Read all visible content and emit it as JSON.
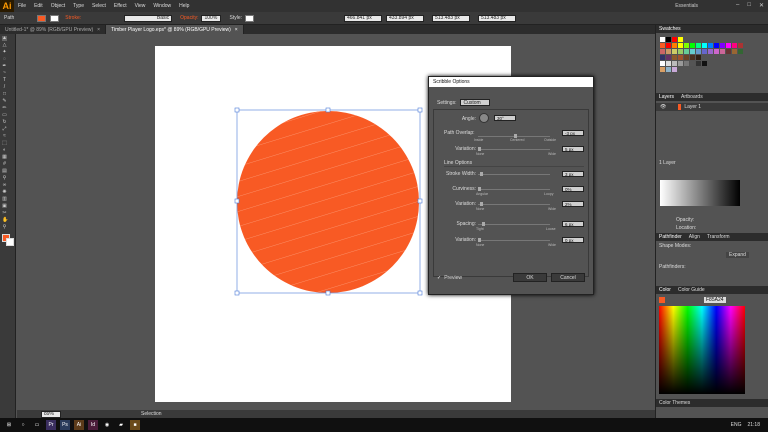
{
  "app": {
    "logo": "Ai"
  },
  "menu": [
    "File",
    "Edit",
    "Object",
    "Type",
    "Select",
    "Effect",
    "View",
    "Window",
    "Help"
  ],
  "workspace": "Essentials",
  "control_bar": {
    "object_label": "Path",
    "stroke_label": "Stroke:",
    "basic_label": "Basic",
    "opacity_label": "Opacity:",
    "opacity_value": "100%",
    "style_label": "Style:",
    "x_value": "466.841 px",
    "y_value": "433.894 px",
    "w_value": "513.483 px",
    "h_value": "513.483 px"
  },
  "tabs": [
    {
      "label": "Untitled-1* @ 89% (RGB/GPU Preview)",
      "active": false
    },
    {
      "label": "Timber Player Logo.eps* @ 89% (RGB/GPU Preview)",
      "active": true
    }
  ],
  "status": {
    "zoom": "89%",
    "tool": "Selection"
  },
  "taskbar": {
    "lang": "ENG",
    "time": "21:18"
  },
  "panels": {
    "swatches": {
      "tab": "Swatches"
    },
    "layers": {
      "tabs": [
        "Layers",
        "Artboards"
      ],
      "layer_name": "Layer 1",
      "count": "1 Layer"
    },
    "gradient": {
      "opacity_label": "Opacity:",
      "location_label": "Location:"
    },
    "pathfinder": {
      "tabs": [
        "Pathfinder",
        "Align",
        "Transform"
      ],
      "shape_modes": "Shape Modes:",
      "pathfinders": "Pathfinders:",
      "expand": "Expand"
    },
    "color": {
      "tabs": [
        "Color",
        "Color Guide"
      ],
      "hex": "F85A24"
    },
    "color_themes": "Color Themes"
  },
  "dialog": {
    "title": "Scribble Options",
    "settings_label": "Settings:",
    "settings_value": "Custom",
    "angle_label": "Angle:",
    "angle_value": "30°",
    "path_overlap_label": "Path Overlap:",
    "path_overlap_value": "-3 px",
    "inside": "Inside",
    "centered": "Centered",
    "outside": "Outside",
    "variation_label": "Variation:",
    "variation1_value": "5 px",
    "none": "None",
    "wide": "Wide",
    "line_options_label": "Line Options",
    "stroke_width_label": "Stroke Width:",
    "stroke_width_value": "3 px",
    "curviness_label": "Curviness:",
    "curviness_value": "0%",
    "angular": "Angular",
    "loopy": "Loopy",
    "variation2_value": "2%",
    "spacing_label": "Spacing:",
    "spacing_value": "6 px",
    "tight": "Tight",
    "loose": "Loose",
    "variation3_value": "0 px",
    "preview_label": "Preview",
    "ok": "OK",
    "cancel": "Cancel"
  },
  "colors": {
    "fill": "#f85a24",
    "accent": "#ff9a00"
  }
}
